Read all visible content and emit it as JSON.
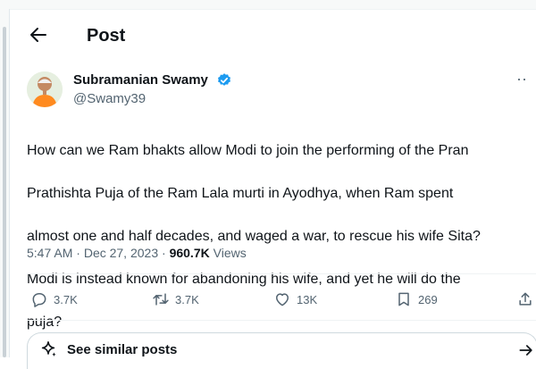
{
  "header": {
    "title": "Post",
    "back_icon": "back-arrow-icon"
  },
  "author": {
    "name": "Subramanian Swamy",
    "handle": "@Swamy39",
    "verified": true,
    "verified_color": "#1d9bf0"
  },
  "more_glyph": "··",
  "post": {
    "text_lines": [
      "How can we Ram bhakts allow Modi to join the performing of the Pran",
      "Prathishta Puja of the Ram Lala murti in Ayodhya, when Ram spent",
      "almost one and half decades, and waged a war, to rescue his wife Sita?",
      "Modi is instead known for abandoning his wife, and yet he will do the",
      "puja?"
    ],
    "time": "5:47 AM",
    "separator": " · ",
    "date": "Dec 27, 2023",
    "views_count": "960.7K",
    "views_label": " Views"
  },
  "actions": {
    "replies": "3.7K",
    "reposts": "3.7K",
    "likes": "13K",
    "bookmarks": "269"
  },
  "similar": {
    "label": "See similar posts"
  },
  "colors": {
    "text": "#0f1419",
    "secondary": "#536471",
    "border": "#eff3f4"
  }
}
